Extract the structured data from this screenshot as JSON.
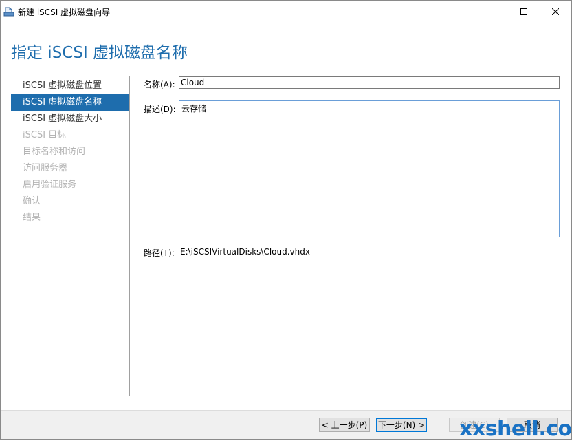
{
  "window": {
    "title": "新建 iSCSI 虚拟磁盘向导",
    "icon": "iscsi-disk-wizard-icon"
  },
  "header": {
    "title": "指定 iSCSI 虚拟磁盘名称"
  },
  "nav": {
    "items": [
      {
        "label": "iSCSI 虚拟磁盘位置",
        "state": "enabled"
      },
      {
        "label": "iSCSI 虚拟磁盘名称",
        "state": "active"
      },
      {
        "label": "iSCSI 虚拟磁盘大小",
        "state": "enabled"
      },
      {
        "label": "iSCSI 目标",
        "state": "disabled"
      },
      {
        "label": "目标名称和访问",
        "state": "disabled"
      },
      {
        "label": "访问服务器",
        "state": "disabled"
      },
      {
        "label": "启用验证服务",
        "state": "disabled"
      },
      {
        "label": "确认",
        "state": "disabled"
      },
      {
        "label": "结果",
        "state": "disabled"
      }
    ]
  },
  "form": {
    "name_label": "名称(A):",
    "name_value": "Cloud",
    "description_label": "描述(D):",
    "description_value": "云存储",
    "path_label": "路径(T):",
    "path_value": "E:\\iSCSIVirtualDisks\\Cloud.vhdx"
  },
  "buttons": {
    "prev": "< 上一步(P)",
    "next": "下一步(N) >",
    "create": "创建(C)",
    "cancel": "取消"
  },
  "watermark": {
    "text": "xxshell.com"
  },
  "colors": {
    "accent": "#1e6dad",
    "disabled_text": "#b4b4b4"
  }
}
